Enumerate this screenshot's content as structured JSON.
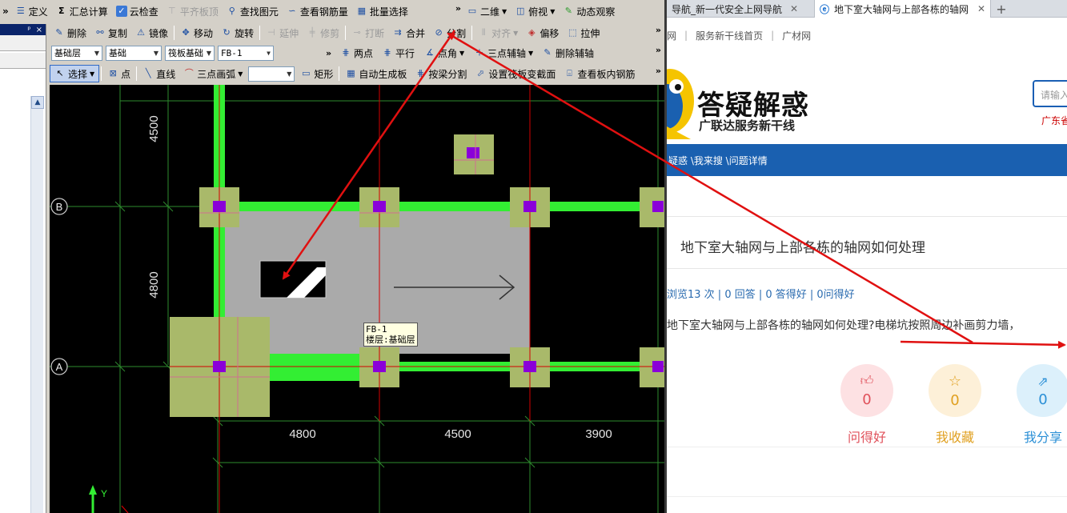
{
  "cad": {
    "toolbar1": {
      "items": [
        {
          "label": "定义",
          "icon": "define-icon"
        },
        {
          "label": "汇总计算",
          "icon": "sigma-icon"
        },
        {
          "label": "云检查",
          "icon": "cloud-check-icon"
        },
        {
          "label": "平齐板顶",
          "icon": "align-top-icon",
          "disabled": true
        },
        {
          "label": "查找图元",
          "icon": "find-icon"
        },
        {
          "label": "查看钢筋量",
          "icon": "rebar-view-icon"
        },
        {
          "label": "批量选择",
          "icon": "batch-select-icon"
        }
      ],
      "view_mode": "二维",
      "view_dir": "俯视",
      "dynamic": "动态观察"
    },
    "toolbar2": {
      "items": [
        {
          "label": "删除",
          "icon": "delete-icon"
        },
        {
          "label": "复制",
          "icon": "copy-icon"
        },
        {
          "label": "镜像",
          "icon": "mirror-icon"
        },
        {
          "label": "移动",
          "icon": "move-icon"
        },
        {
          "label": "旋转",
          "icon": "rotate-icon"
        },
        {
          "label": "延伸",
          "icon": "extend-icon",
          "disabled": true
        },
        {
          "label": "修剪",
          "icon": "trim-icon",
          "disabled": true
        },
        {
          "label": "打断",
          "icon": "break-icon",
          "disabled": true
        },
        {
          "label": "合并",
          "icon": "merge-icon"
        },
        {
          "label": "分割",
          "icon": "split-icon"
        },
        {
          "label": "对齐",
          "icon": "align-icon",
          "disabled": true
        },
        {
          "label": "偏移",
          "icon": "offset-icon"
        },
        {
          "label": "拉伸",
          "icon": "stretch-icon"
        }
      ]
    },
    "toolbar3": {
      "floor": "基础层",
      "category": "基础",
      "component_type": "筏板基础",
      "component": "FB-1",
      "aux": [
        {
          "label": "两点",
          "icon": "two-point-icon"
        },
        {
          "label": "平行",
          "icon": "parallel-icon"
        },
        {
          "label": "点角",
          "icon": "point-angle-icon"
        },
        {
          "label": "三点辅轴",
          "icon": "three-point-axis-icon"
        },
        {
          "label": "删除辅轴",
          "icon": "delete-axis-icon"
        }
      ]
    },
    "toolbar4": {
      "select": "选择",
      "items": [
        {
          "label": "点",
          "icon": "point-icon"
        },
        {
          "label": "直线",
          "icon": "line-icon"
        },
        {
          "label": "三点画弧",
          "icon": "arc-icon"
        },
        {
          "label": "矩形",
          "icon": "rect-icon"
        },
        {
          "label": "自动生成板",
          "icon": "auto-slab-icon"
        },
        {
          "label": "按梁分割",
          "icon": "beam-split-icon"
        },
        {
          "label": "设置筏板变截面",
          "icon": "variable-section-icon"
        },
        {
          "label": "查看板内钢筋",
          "icon": "slab-rebar-icon"
        }
      ]
    },
    "left_panel": {
      "pin": "ᵖ",
      "close": "×"
    },
    "drawing": {
      "axes": [
        "B",
        "A"
      ],
      "dims_vertical": [
        "4500",
        "4800"
      ],
      "dims_horizontal": [
        "4800",
        "4500",
        "3900"
      ],
      "tooltip_line1": "FB-1",
      "tooltip_line2": "楼层:基础层",
      "coord_y": "Y",
      "colors": {
        "beam": "#33ee33",
        "slab": "#aaaaaa",
        "column_cap": "#a9b96a",
        "column": "#8a00d9",
        "axis": "#2e8b2e",
        "red_line": "#d40000"
      }
    }
  },
  "browser": {
    "tabs": [
      {
        "label": "导航_新一代安全上网导航",
        "active": false
      },
      {
        "label": "地下室大轴网与上部各栋的轴网",
        "active": true
      }
    ],
    "favbar": [
      "网",
      "服务新干线首页",
      "广材网"
    ],
    "site": {
      "logo_text": "答疑解惑",
      "logo_sub": "广联达服务新干线",
      "search_placeholder": "请输入",
      "region": "广东省"
    },
    "breadcrumb": "疑惑 \\我来搜 \\问题详情",
    "question_title": "地下室大轴网与上部各栋的轴网如何处理",
    "stats": "浏览13 次 | 0 回答 | 0 答得好 | 0问得好",
    "question_body": "地下室大轴网与上部各栋的轴网如何处理?电梯坑按照周边补画剪力墙，",
    "actions": [
      {
        "label": "问得好",
        "count": "0",
        "icon": "thumbs-up-icon",
        "color": "#e0505a",
        "bg": "#fde1e3"
      },
      {
        "label": "我收藏",
        "count": "0",
        "icon": "star-icon",
        "color": "#e0a020",
        "bg": "#fdf0d8"
      },
      {
        "label": "我分享",
        "count": "0",
        "icon": "share-icon",
        "color": "#2a8fd6",
        "bg": "#dcf0fb"
      }
    ]
  }
}
